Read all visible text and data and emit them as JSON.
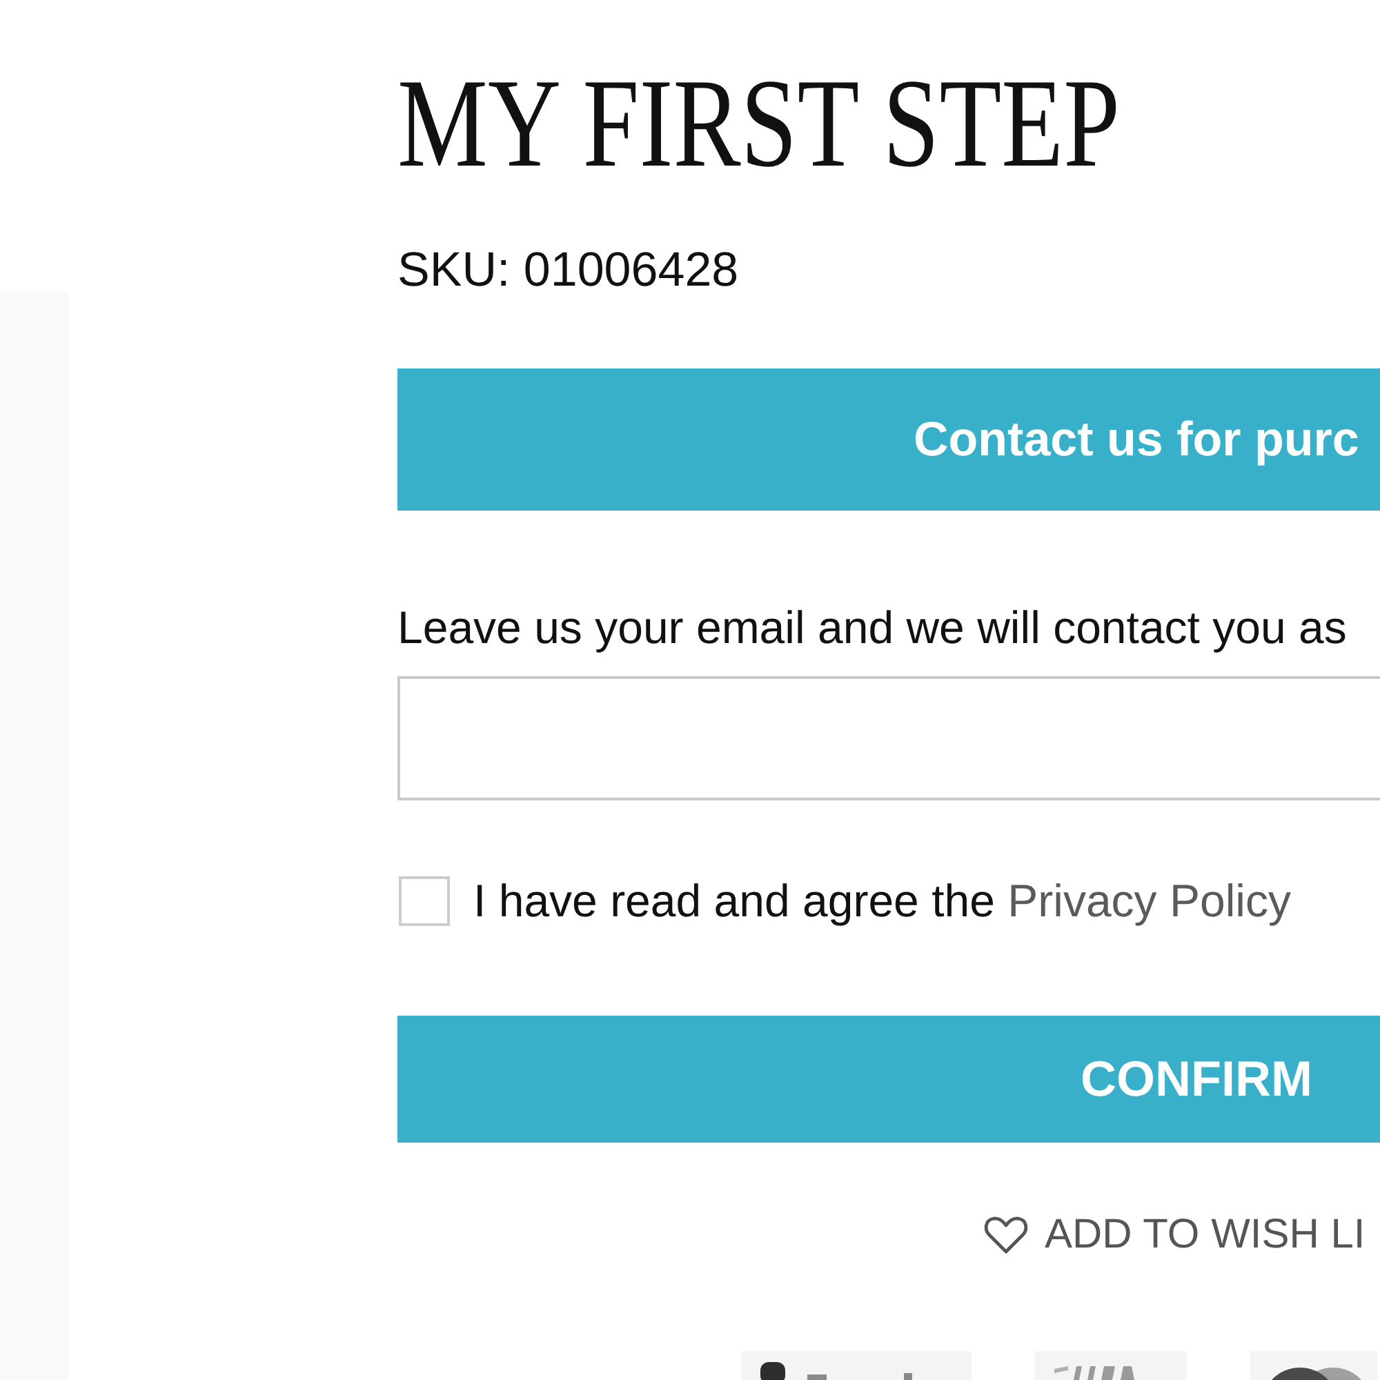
{
  "product": {
    "title": "MY FIRST STEP",
    "sku": "SKU: 01006428"
  },
  "contact_button": {
    "label": "Contact us for purc"
  },
  "email_form": {
    "prompt": "Leave us your email and we will contact you as"
  },
  "consent": {
    "text": "I have read and agree the",
    "link": "Privacy Policy",
    "checked": false
  },
  "confirm_button": {
    "label": "CONFIRM"
  },
  "wishlist": {
    "label": "ADD TO WISH LI"
  }
}
